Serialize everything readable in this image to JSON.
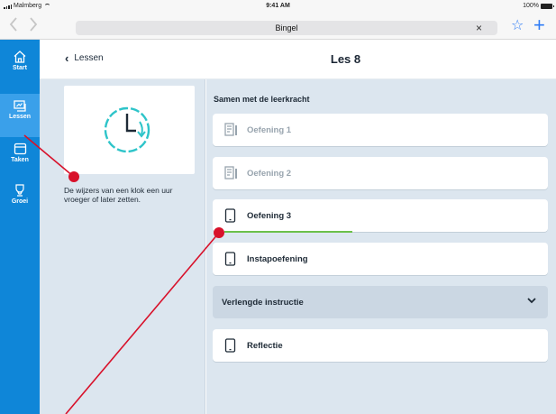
{
  "status_bar": {
    "carrier": "Malmberg",
    "time": "9:41 AM",
    "battery": "100%"
  },
  "browser": {
    "back_icon": "chevron-left",
    "forward_icon": "chevron-right",
    "url": "Bingel",
    "clear_icon": "×",
    "bookmark_icon": "☆",
    "new_tab_icon": "+"
  },
  "sidebar": {
    "items": [
      {
        "label": "Start",
        "icon": "home-icon"
      },
      {
        "label": "Lessen",
        "icon": "lessons-icon"
      },
      {
        "label": "Taken",
        "icon": "tasks-icon"
      },
      {
        "label": "Groei",
        "icon": "growth-icon"
      }
    ],
    "active": "Lessen"
  },
  "header": {
    "back_label": "Lessen",
    "title": "Les 8"
  },
  "lesson": {
    "description": "De wijzers van een klok een uur vroeger of later zetten."
  },
  "exercises": {
    "section_title": "Samen met de leerkracht",
    "items": [
      {
        "label": "Oefening 1",
        "state": "done"
      },
      {
        "label": "Oefening 2",
        "state": "done"
      },
      {
        "label": "Oefening 3",
        "state": "in-progress",
        "progress": 0.41
      },
      {
        "label": "Instapoefening",
        "state": "open"
      }
    ],
    "accordion_label": "Verlengde instructie",
    "extra_item": "Reflectie"
  },
  "colors": {
    "sidebar": "#0f86d8",
    "sidebar_active": "#3aa0ea",
    "panel_bg": "#dce6ef",
    "clock": "#2ec4c9",
    "progress": "#6cc04a",
    "annotation": "#d8112a"
  }
}
